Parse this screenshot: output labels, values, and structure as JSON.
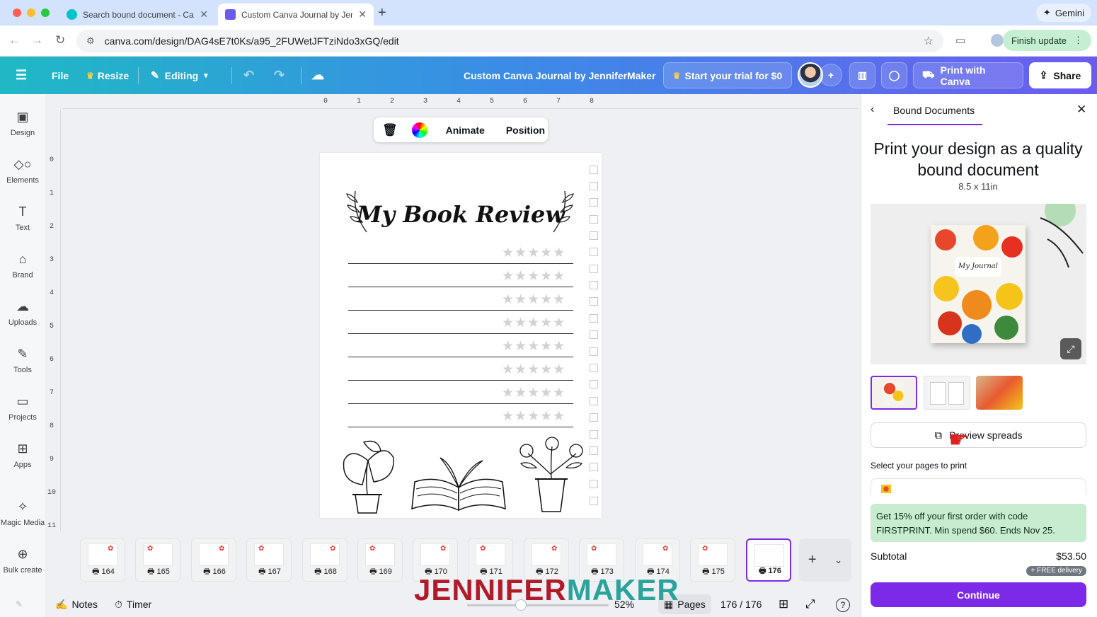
{
  "browser": {
    "tabs": [
      {
        "title": "Search bound document - Canva"
      },
      {
        "title": "Custom Canva Journal by JenniferMaker"
      }
    ],
    "gemini_label": "Gemini",
    "url": "canva.com/design/DAG4sE7t0Ks/a95_2FUWetJFTziNdo3xGQ/edit",
    "finish_update_label": "Finish update"
  },
  "toolbar": {
    "file_label": "File",
    "resize_label": "Resize",
    "editing_label": "Editing",
    "doc_title": "Custom Canva Journal by JenniferMaker",
    "trial_label": "Start your trial for $0",
    "print_label": "Print with Canva",
    "share_label": "Share"
  },
  "sidebar": {
    "items": [
      {
        "label": "Design",
        "icon": "design-icon"
      },
      {
        "label": "Elements",
        "icon": "elements-icon"
      },
      {
        "label": "Text",
        "icon": "text-icon"
      },
      {
        "label": "Brand",
        "icon": "brand-icon"
      },
      {
        "label": "Uploads",
        "icon": "uploads-icon"
      },
      {
        "label": "Tools",
        "icon": "tools-icon"
      },
      {
        "label": "Projects",
        "icon": "projects-icon"
      },
      {
        "label": "Apps",
        "icon": "apps-icon"
      },
      {
        "label": "Magic Media",
        "icon": "magic-media-icon"
      },
      {
        "label": "Bulk create",
        "icon": "bulk-create-icon"
      }
    ]
  },
  "rulers": {
    "top": [
      "0",
      "1",
      "2",
      "3",
      "4",
      "5",
      "6",
      "7",
      "8"
    ],
    "left": [
      "0",
      "1",
      "2",
      "3",
      "4",
      "5",
      "6",
      "7",
      "8",
      "9",
      "10",
      "11"
    ]
  },
  "context_toolbar": {
    "animate_label": "Animate",
    "position_label": "Position"
  },
  "page": {
    "title": "My Book Review",
    "review_rows": 8,
    "stars_per_row": 5
  },
  "page_strip": {
    "pages": [
      "164",
      "165",
      "166",
      "167",
      "168",
      "169",
      "170",
      "171",
      "172",
      "173",
      "174",
      "175",
      "176"
    ],
    "selected": "176"
  },
  "bottom_bar": {
    "notes_label": "Notes",
    "timer_label": "Timer",
    "zoom": "52%",
    "pages_label": "Pages",
    "page_counter": "176 / 176"
  },
  "watermark": {
    "jennifer": "JENNIFER",
    "maker": "MAKER"
  },
  "panel": {
    "title": "Bound Documents",
    "heading": "Print your design as a quality bound document",
    "size": "8.5 x 11in",
    "notebook_label": "My Journal",
    "preview_label": "Preview spreads",
    "select_label": "Select your pages to print",
    "promo": "Get 15% off your first order with code FIRSTPRINT. Min spend $60. Ends Nov 25.",
    "subtotal_label": "Subtotal",
    "subtotal_value": "$53.50",
    "delivery_badge": "+ FREE delivery",
    "continue_label": "Continue"
  },
  "colors": {
    "accent": "#7d2ae8",
    "promo_bg": "#c7eccf",
    "watermark_red": "#b01b2a",
    "watermark_teal": "#2aa39b"
  }
}
